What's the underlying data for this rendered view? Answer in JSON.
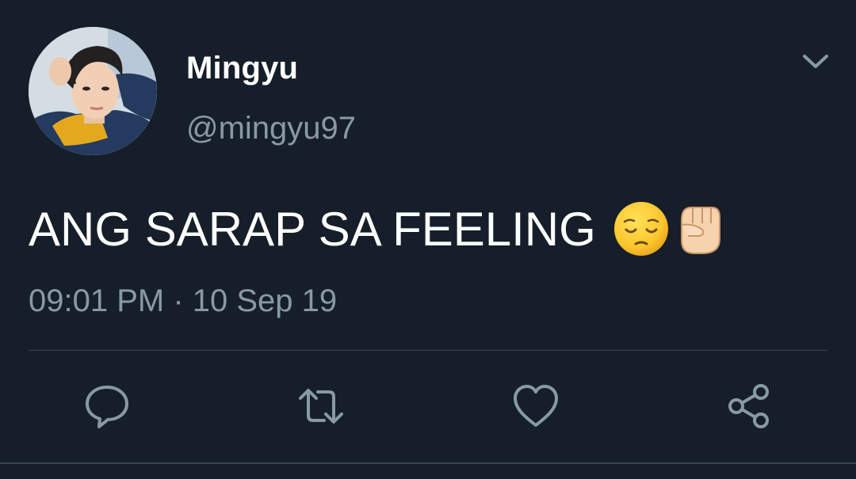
{
  "tweet": {
    "author": {
      "display_name": "Mingyu",
      "handle": "@mingyu97"
    },
    "text": "ANG SARAP SA FEELING",
    "emojis": [
      "pensive-face-emoji",
      "raised-fist-emoji"
    ],
    "timestamp": "09:01 PM · 10 Sep 19"
  },
  "actions": [
    {
      "name": "reply",
      "icon": "reply-icon"
    },
    {
      "name": "retweet",
      "icon": "retweet-icon"
    },
    {
      "name": "like",
      "icon": "heart-icon"
    },
    {
      "name": "share",
      "icon": "share-icon"
    }
  ],
  "menu": {
    "icon": "chevron-down-icon"
  },
  "colors": {
    "background": "#161e29",
    "primary_text": "#ffffff",
    "secondary_text": "#8899a6",
    "divider": "#38444d"
  }
}
